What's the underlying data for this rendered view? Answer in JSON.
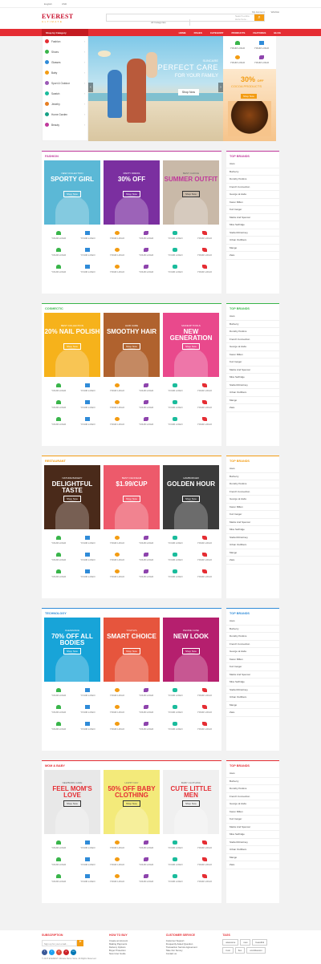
{
  "topbar": {
    "lang": "English",
    "currency": "USD",
    "account": "My Account",
    "wishlist": "Wishlist"
  },
  "logo": {
    "name": "EVEREST",
    "tagline": "ULTIMATE"
  },
  "search": {
    "category": "All Categories",
    "placeholder": "Search entire store here..."
  },
  "nav": {
    "shop_by": "Shop by Category",
    "links": [
      "HOME",
      "PAGES",
      "CATEGORY",
      "PRODUCTS",
      "FEATURES",
      "BLOG"
    ]
  },
  "sidebar": [
    "Fashion",
    "Shoes",
    "Glasses",
    "Baby",
    "Sport & Outdoor",
    "Swatch",
    "Jewelry",
    "Home Garden",
    "Beauty"
  ],
  "slider": {
    "kicker": "SUNCARE",
    "title": "PERFECT CARE",
    "subtitle": "FOR YOUR FAMILY",
    "button": "Shop Now"
  },
  "promo": {
    "percent": "30%",
    "off": "OFF",
    "label": "COCOA PRODUCTS",
    "button": "Shop Now"
  },
  "your_logo": "YOUR LOGO",
  "brands_title": "TOP BRANDS",
  "brands": [
    "Asos",
    "Burberry",
    "Dorothy Perkins",
    "French Connection",
    "George at Asda",
    "Karen Millen",
    "Kurt Geiger",
    "Marks And Spencer",
    "Miss Selfridge",
    "Stella McCartney",
    "Urban Outfitters",
    "Mango",
    "Zara"
  ],
  "categories": [
    {
      "title": "FASHION",
      "color": "#c0399b",
      "banners": [
        {
          "small": "NEW COLLECTION",
          "title": "SPORTY GIRL",
          "button": "Shop Now",
          "bg": "#5bb8d6"
        },
        {
          "small": "PARTY DRESS",
          "title": "30% OFF",
          "button": "Shop Now",
          "bg": "#7b2fa0"
        },
        {
          "small": "BEST CHOICE",
          "title": "SUMMER OUTFIT",
          "button": "Shop Now",
          "bg": "#c9b9a8"
        }
      ]
    },
    {
      "title": "COSMECTIC",
      "color": "#39b54a",
      "banners": [
        {
          "small": "BEST COLLECTION",
          "title": "20% NAIL POLISH",
          "button": "Shop Now",
          "bg": "#f6b21b"
        },
        {
          "small": "HAIR CARE",
          "title": "SMOOTHY HAIR",
          "button": "Shop Now",
          "bg": "#b0622e"
        },
        {
          "small": "MAKEUP TOOLS",
          "title": "NEW GENERATION",
          "button": "Shop Now",
          "bg": "#e9498c"
        }
      ]
    },
    {
      "title": "RESTAURANT",
      "color": "#f39c12",
      "banners": [
        {
          "small": "NATURE BAKERY",
          "title": "DELIGHTFUL TASTE",
          "button": "Shop Now",
          "bg": "#4a2a1a"
        },
        {
          "small": "BEST ICECREAM",
          "title": "$1.99/CUP",
          "button": "Shop Now",
          "bg": "#ed5a6b"
        },
        {
          "small": "HAMBURGER",
          "title": "GOLDEN HOUR",
          "button": "Shop Now",
          "bg": "#3b3b3b"
        }
      ]
    },
    {
      "title": "TECHNOLOGY",
      "color": "#2f8bd8",
      "banners": [
        {
          "small": "CLEARANCE",
          "title": "70% OFF ALL BODIES",
          "button": "Shop Now",
          "bg": "#18a4d8"
        },
        {
          "small": "YOUTH'S",
          "title": "SMART CHOICE",
          "button": "Shop Now",
          "bg": "#e6553d"
        },
        {
          "small": "PHONE CASE",
          "title": "NEW LOOK",
          "button": "Shop Now",
          "bg": "#b51f6e"
        }
      ]
    },
    {
      "title": "MOM & BABY",
      "color": "#e52d33",
      "banners": [
        {
          "small": "NEWBORN CARE",
          "title": "FEEL MOM'S LOVE",
          "button": "Shop Now",
          "bg": "#e8e8e8"
        },
        {
          "small": "HAPPY DAY",
          "title": "50% OFF BABY CLOTHING",
          "button": "Shop Now",
          "bg": "#f3ea7a"
        },
        {
          "small": "BABY CLOTHING",
          "title": "CUTE LITTLE MEN",
          "button": "Shop Now",
          "bg": "#f0f0f0"
        }
      ]
    }
  ],
  "footer": {
    "subscription": "SUBSCRIPTION",
    "sub_placeholder": "Sign up for your email...",
    "how_to_buy": "HOW TO BUY",
    "how_items": [
      "Create an Account",
      "Making Payments",
      "Delivery Options",
      "Buyer Protection",
      "New User Guide"
    ],
    "customer": "CUSTOMER SERVICE",
    "cust_items": [
      "Customer Support",
      "Frequently Asked Question",
      "Transaction Service Agreement",
      "Take Our Survey",
      "Contact us"
    ],
    "tags": "TAGS",
    "tag_items": [
      "awesome",
      "new",
      "beautiful",
      "trust",
      "flex",
      "unmillsonion"
    ],
    "copyright": "© 2017 EVEREST Ultimate Demo Store. All Rights Reserved."
  }
}
